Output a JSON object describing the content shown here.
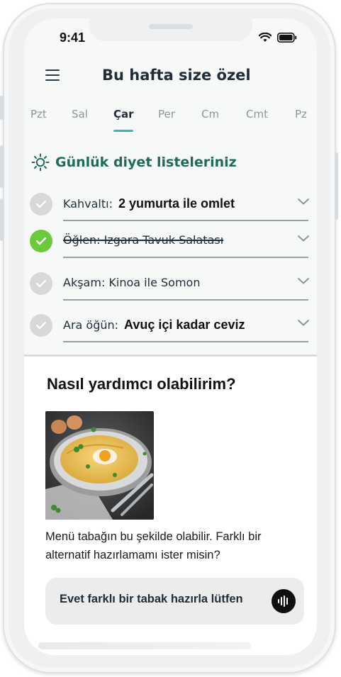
{
  "status_bar": {
    "time": "9:41"
  },
  "header": {
    "title": "Bu hafta size özel"
  },
  "days": [
    {
      "label": "Pzt",
      "active": false
    },
    {
      "label": "Sal",
      "active": false
    },
    {
      "label": "Çar",
      "active": true
    },
    {
      "label": "Per",
      "active": false
    },
    {
      "label": "Cm",
      "active": false
    },
    {
      "label": "Cmt",
      "active": false
    },
    {
      "label": "Pz",
      "active": false
    }
  ],
  "diet": {
    "section_title": "Günlük diyet listeleriniz",
    "meals": [
      {
        "label": "Kahvaltı:",
        "value": "2 yumurta ile omlet",
        "done": false
      },
      {
        "label": "Öğlen: Izgara Tavuk Salatası",
        "value": "",
        "done": true
      },
      {
        "label": "Akşam: Kinoa ile Somon",
        "value": "",
        "done": false
      },
      {
        "label": "Ara öğün:",
        "value": "Avuç içi kadar ceviz",
        "done": false
      }
    ]
  },
  "assistant": {
    "title": "Nasıl yardımcı olabilirim?",
    "message": "Menü tabağın bu şekilde olabilir. Farklı bir alternatif hazırlamamı ister misin?",
    "input_text": "Evet farklı bir tabak hazırla lütfen"
  },
  "colors": {
    "accent_teal": "#3bb4c1",
    "section_green": "#1f6b5a",
    "check_done": "#6cc93c",
    "check_pending": "#d6d8da"
  },
  "icons": [
    "menu-icon",
    "wifi-icon",
    "battery-icon",
    "sun-icon",
    "check-icon",
    "chevron-down-icon",
    "voice-icon"
  ]
}
